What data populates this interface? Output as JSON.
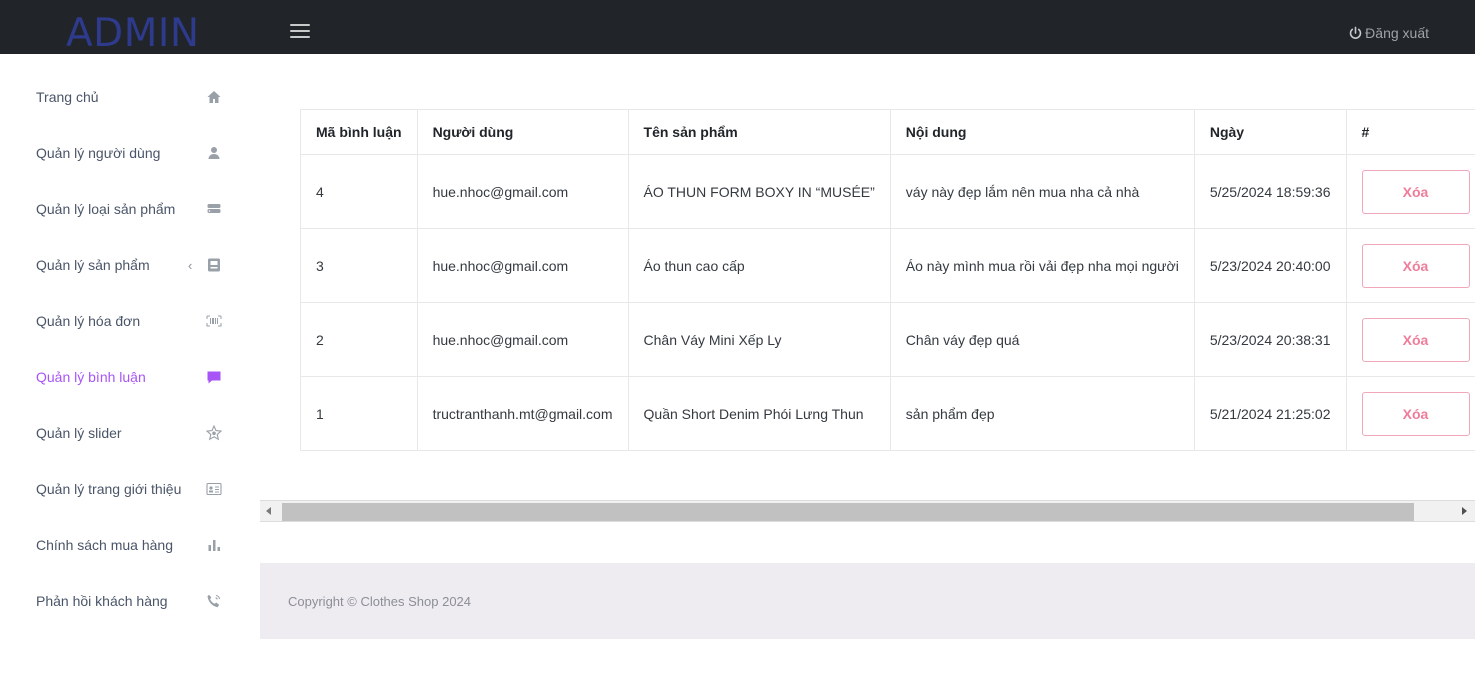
{
  "header": {
    "brand": "ADMIN",
    "logout_label": "Đăng xuất"
  },
  "sidebar": {
    "items": [
      {
        "label": "Trang chủ",
        "icon": "home-icon"
      },
      {
        "label": "Quản lý người dùng",
        "icon": "user-icon"
      },
      {
        "label": "Quản lý loại sản phẩm",
        "icon": "database-icon"
      },
      {
        "label": "Quản lý sản phẩm",
        "icon": "product-icon",
        "chevron": "‹"
      },
      {
        "label": "Quản lý hóa đơn",
        "icon": "barcode-icon"
      },
      {
        "label": "Quản lý bình luận",
        "icon": "comment-icon",
        "active": true
      },
      {
        "label": "Quản lý slider",
        "icon": "star-icon"
      },
      {
        "label": "Quản lý trang giới thiệu",
        "icon": "id-card-icon"
      },
      {
        "label": "Chính sách mua hàng",
        "icon": "bar-chart-icon"
      },
      {
        "label": "Phản hồi khách hàng",
        "icon": "phone-icon"
      }
    ],
    "active_color": "#a855f7"
  },
  "table": {
    "headers": [
      "Mã bình luận",
      "Người dùng",
      "Tên sản phẩm",
      "Nội dung",
      "Ngày",
      "#"
    ],
    "rows": [
      {
        "id": "4",
        "user": "hue.nhoc@gmail.com",
        "product": "ÁO THUN FORM BOXY IN “MUSÉE”",
        "content": "váy này đẹp lắm nên mua nha cả nhà",
        "date": "5/25/2024 18:59:36",
        "action": "Xóa"
      },
      {
        "id": "3",
        "user": "hue.nhoc@gmail.com",
        "product": "Áo thun cao cấp",
        "content": "Áo này mình mua rồi vải đẹp nha mọi người",
        "date": "5/23/2024 20:40:00",
        "action": "Xóa"
      },
      {
        "id": "2",
        "user": "hue.nhoc@gmail.com",
        "product": "Chân Váy Mini Xếp Ly",
        "content": "Chân váy đẹp quá",
        "date": "5/23/2024 20:38:31",
        "action": "Xóa"
      },
      {
        "id": "1",
        "user": "tructranthanh.mt@gmail.com",
        "product": "Quần Short Denim Phói Lưng Thun",
        "content": "sản phẩm đẹp",
        "date": "5/21/2024 21:25:02",
        "action": "Xóa"
      }
    ]
  },
  "footer": {
    "copyright": "Copyright © Clothes Shop 2024"
  },
  "colors": {
    "topbar": "#212529",
    "brand": "#2e3a8c",
    "delete_button": "#ef7c9a",
    "footer_bg": "#efecf1"
  }
}
